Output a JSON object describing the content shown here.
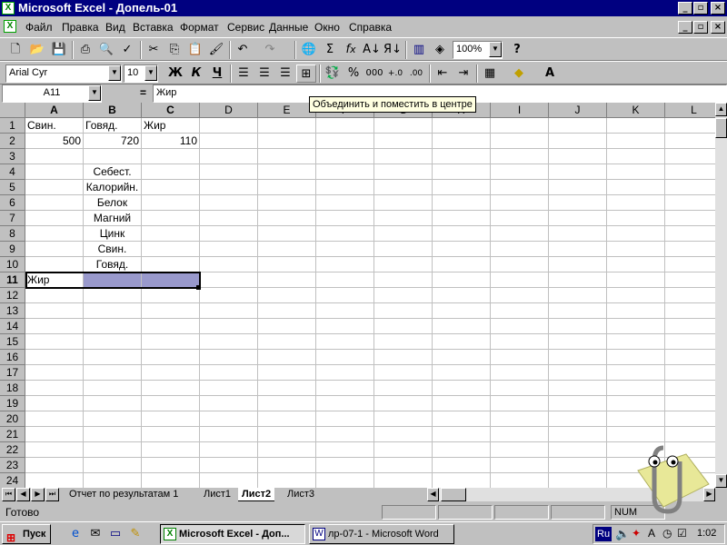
{
  "window": {
    "title": "Microsoft Excel - Допель-01"
  },
  "menu": [
    "Файл",
    "Правка",
    "Вид",
    "Вставка",
    "Формат",
    "Сервис",
    "Данные",
    "Окно",
    "Справка"
  ],
  "toolbar": {
    "zoom": "100%",
    "font": "Arial Cyr",
    "size": "10",
    "bold": "Ж",
    "italic": "К",
    "underline": "Ч"
  },
  "formula_bar": {
    "name_box": "A11",
    "equals": "=",
    "content": "Жир"
  },
  "tooltip": "Объединить и поместить в центре",
  "columns": [
    "A",
    "B",
    "C",
    "D",
    "E",
    "F",
    "G",
    "H",
    "I",
    "J",
    "K",
    "L"
  ],
  "rows": [
    "1",
    "2",
    "3",
    "4",
    "5",
    "6",
    "7",
    "8",
    "9",
    "10",
    "11",
    "12",
    "13",
    "14",
    "15",
    "16",
    "17",
    "18",
    "19",
    "20",
    "21",
    "22",
    "23",
    "24"
  ],
  "cells": {
    "A1": "Свин.",
    "B1": "Говяд.",
    "C1": "Жир",
    "A2": "500",
    "B2": "720",
    "C2": "110",
    "B4": "Себест.",
    "B5": "Калорийн.",
    "B6": "Белок",
    "B7": "Магний",
    "B8": "Цинк",
    "B9": "Свин.",
    "B10": "Говяд.",
    "A11": "Жир"
  },
  "sheets": [
    "Отчет по результатам 1",
    "Лист1",
    "Лист2",
    "Лист3"
  ],
  "status": {
    "text": "Готово",
    "num": "NUM"
  },
  "taskbar": {
    "start": "Пуск",
    "excel": "Microsoft Excel - Доп...",
    "word": "лр-07-1 - Microsoft Word",
    "lang": "Ru",
    "clock": "1:02"
  }
}
